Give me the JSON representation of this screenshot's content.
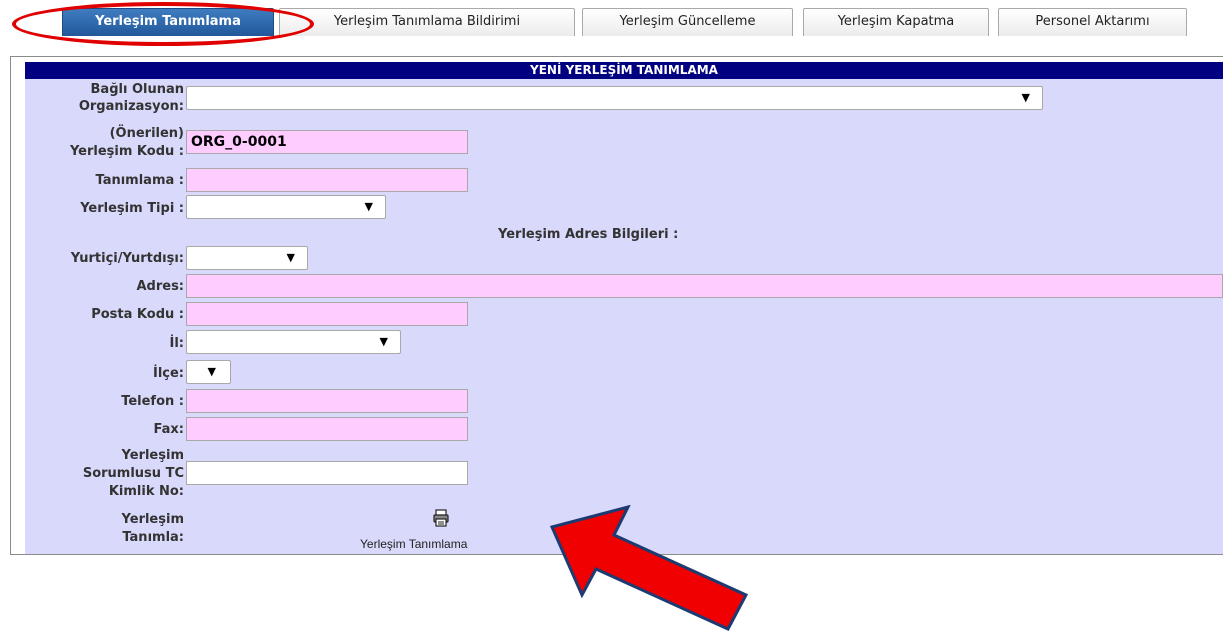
{
  "tabs": [
    {
      "label": "Yerleşim Tanımlama",
      "active": true
    },
    {
      "label": "Yerleşim Tanımlama Bildirimi",
      "active": false
    },
    {
      "label": "Yerleşim Güncelleme",
      "active": false
    },
    {
      "label": "Yerleşim Kapatma",
      "active": false
    },
    {
      "label": "Personel Aktarımı",
      "active": false
    }
  ],
  "form": {
    "title": "YENİ YERLEŞİM TANIMLAMA",
    "bagli_label_1": "Bağlı Olunan",
    "bagli_label_2": "Organizasyon:",
    "onerilen_label_1": "(Önerilen)",
    "onerilen_label_2": "Yerleşim Kodu :",
    "onerilen_value": "ORG_0-0001",
    "tanimlama_label": "Tanımlama :",
    "tanimlama_value": "",
    "tipi_label": "Yerleşim Tipi :",
    "address_section_title": "Yerleşim Adres Bilgileri :",
    "yurtici_label": "Yurtiçi/Yurtdışı:",
    "adres_label": "Adres:",
    "adres_value": "",
    "posta_label": "Posta Kodu :",
    "posta_value": "",
    "il_label": "İl:",
    "ilce_label": "İlçe:",
    "telefon_label": "Telefon :",
    "telefon_value": "",
    "fax_label": "Fax:",
    "fax_value": "",
    "sorumlu_label_1": "Yerleşim",
    "sorumlu_label_2": "Sorumlusu TC",
    "sorumlu_label_3": "Kimlik No:",
    "sorumlu_value": "",
    "tanimla_label_1": "Yerleşim",
    "tanimla_label_2": "Tanımla:",
    "action_label": "Yerleşim Tanımlama"
  },
  "icons": {
    "dropdown": "chevron-down-icon",
    "action": "printer-icon"
  },
  "colors": {
    "title_bar": "#000080",
    "panel_bg": "#d9d9fb",
    "required_field": "#ffccff",
    "active_tab": "#2a64a8",
    "annotation_red": "#e00000"
  }
}
